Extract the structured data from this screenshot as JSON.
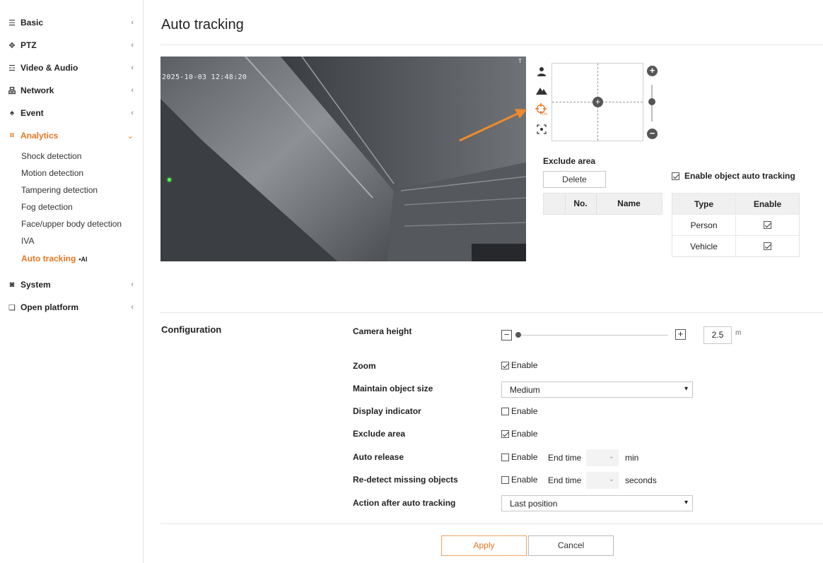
{
  "sidebar": {
    "items": [
      {
        "label": "Basic",
        "icon": "list-icon"
      },
      {
        "label": "PTZ",
        "icon": "move-icon"
      },
      {
        "label": "Video & Audio",
        "icon": "sliders-icon"
      },
      {
        "label": "Network",
        "icon": "network-icon"
      },
      {
        "label": "Event",
        "icon": "bell-icon"
      },
      {
        "label": "Analytics",
        "icon": "analytics-icon"
      },
      {
        "label": "System",
        "icon": "system-icon"
      },
      {
        "label": "Open platform",
        "icon": "platform-icon"
      }
    ],
    "analytics_sub": [
      {
        "label": "Shock detection"
      },
      {
        "label": "Motion detection"
      },
      {
        "label": "Tampering detection"
      },
      {
        "label": "Fog detection"
      },
      {
        "label": "Face/upper body detection"
      },
      {
        "label": "IVA"
      },
      {
        "label": "Auto tracking",
        "badge": "•AI"
      }
    ],
    "accent_color": "#e87722"
  },
  "page": {
    "title": "Auto tracking"
  },
  "video": {
    "timestamp": "2025-10-03 12:48:20",
    "corner_mark": "T"
  },
  "tools": {
    "icons": [
      "person-icon",
      "mountain-icon",
      "target-icon",
      "focus-icon"
    ],
    "target_badge": "On"
  },
  "ptz": {
    "zoom_in": "+",
    "zoom_out": "−",
    "center": "+"
  },
  "exclude_area": {
    "title": "Exclude area",
    "delete_label": "Delete",
    "columns": [
      "No.",
      "Name"
    ]
  },
  "object_tracking": {
    "enable_label": "Enable object auto tracking",
    "enabled": true,
    "columns": [
      "Type",
      "Enable"
    ],
    "rows": [
      {
        "type": "Person",
        "enabled": true
      },
      {
        "type": "Vehicle",
        "enabled": true
      }
    ]
  },
  "configuration": {
    "title": "Configuration",
    "camera_height": {
      "label": "Camera height",
      "value": "2.5",
      "unit": "m",
      "minus": "−",
      "plus": "+"
    },
    "zoom": {
      "label": "Zoom",
      "option": "Enable",
      "checked": true
    },
    "maintain_size": {
      "label": "Maintain object size",
      "value": "Medium"
    },
    "display_indicator": {
      "label": "Display indicator",
      "option": "Enable",
      "checked": false
    },
    "exclude_area": {
      "label": "Exclude area",
      "option": "Enable",
      "checked": true
    },
    "auto_release": {
      "label": "Auto release",
      "option": "Enable",
      "checked": false,
      "end_time_label": "End time",
      "unit": "min"
    },
    "redetect": {
      "label": "Re-detect missing objects",
      "option": "Enable",
      "checked": false,
      "end_time_label": "End time",
      "unit": "seconds"
    },
    "action_after": {
      "label": "Action after auto tracking",
      "value": "Last position"
    }
  },
  "footer": {
    "apply_label": "Apply",
    "cancel_label": "Cancel"
  }
}
